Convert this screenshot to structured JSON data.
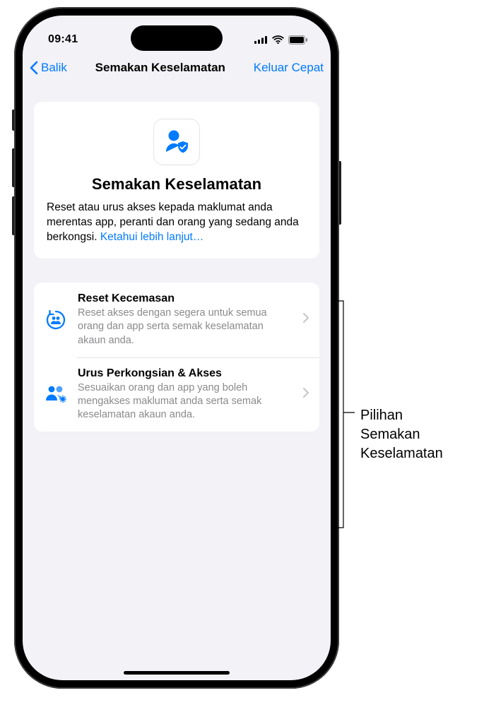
{
  "status": {
    "time": "09:41"
  },
  "nav": {
    "back_label": "Balik",
    "title": "Semakan Keselamatan",
    "quick_exit": "Keluar Cepat"
  },
  "hero": {
    "title": "Semakan Keselamatan",
    "description": "Reset atau urus akses kepada maklumat anda merentas app, peranti dan orang yang sedang anda berkongsi. ",
    "learn_more": "Ketahui lebih lanjut…"
  },
  "options": [
    {
      "title": "Reset Kecemasan",
      "description": "Reset akses dengan segera untuk semua orang dan app serta semak keselamatan akaun anda."
    },
    {
      "title": "Urus Perkongsian & Akses",
      "description": "Sesuaikan orang dan app yang boleh mengakses maklumat anda serta semak keselamatan akaun anda."
    }
  ],
  "annotation": {
    "label": "Pilihan\nSemakan\nKeselamatan"
  }
}
